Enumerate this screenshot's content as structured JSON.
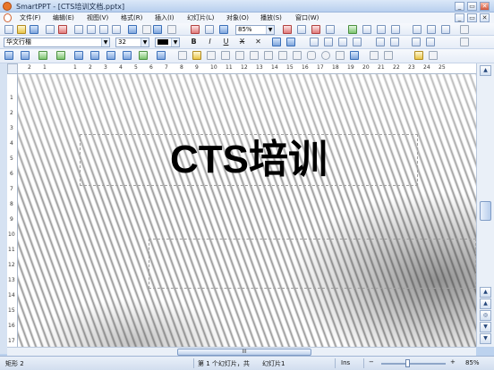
{
  "window": {
    "title": "SmartPPT - [CTS培训文档.pptx]",
    "minimize": "_",
    "restore": "▭",
    "close": "✕"
  },
  "menu": [
    "文件(F)",
    "编辑(E)",
    "视图(V)",
    "格式(R)",
    "插入(I)",
    "幻灯片(L)",
    "对象(O)",
    "播放(S)",
    "窗口(W)"
  ],
  "doc_controls": {
    "minimize": "_",
    "restore": "▭",
    "close": "✕"
  },
  "toolbar": {
    "zoom": "85%",
    "font": "华文行楷",
    "size": "32",
    "bold": "B",
    "italic": "I",
    "underline": "U",
    "strike": "X"
  },
  "ruler": {
    "h": [
      "2",
      "1",
      "",
      "1",
      "2",
      "3",
      "4",
      "5",
      "6",
      "7",
      "8",
      "9",
      "10",
      "11",
      "12",
      "13",
      "14",
      "15",
      "16",
      "17",
      "18",
      "19",
      "20",
      "21",
      "22",
      "23",
      "24",
      "25"
    ],
    "v": [
      "1",
      "2",
      "3",
      "4",
      "5",
      "6",
      "7",
      "8",
      "9",
      "10",
      "11",
      "12",
      "13",
      "14",
      "15",
      "16",
      "17"
    ]
  },
  "slide": {
    "title": "CTS培训"
  },
  "hscroll": {
    "grip": "III"
  },
  "status": {
    "shape": "矩形 2",
    "slide_pos": "第 1 个幻灯片，共",
    "slide_name": "幻灯片1",
    "mode": "Ins",
    "zoom": "85%",
    "zoom_minus": "−",
    "zoom_plus": "+"
  }
}
